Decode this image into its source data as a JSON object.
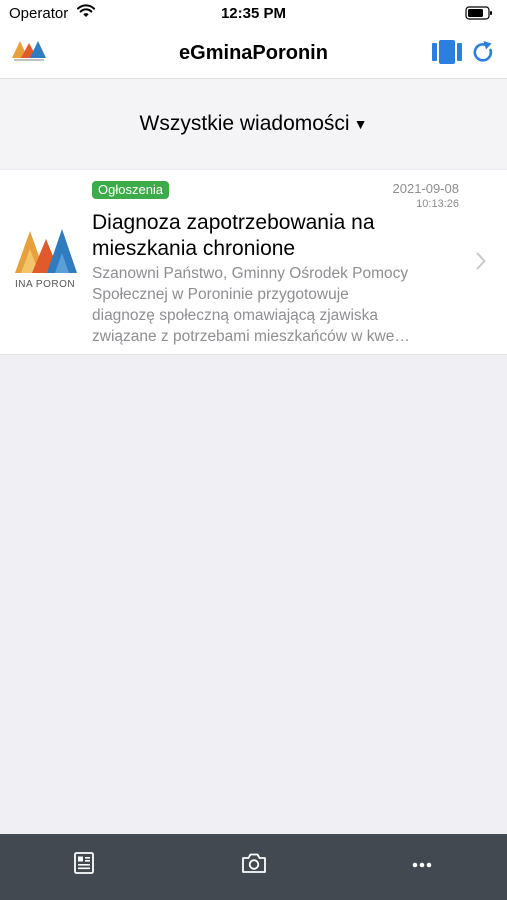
{
  "status_bar": {
    "carrier": "Operator",
    "time": "12:35 PM"
  },
  "nav": {
    "title": "eGminaPoronin",
    "accent_color": "#2a7fe0"
  },
  "filter": {
    "label": "Wszystkie wiadomości",
    "caret": "▼"
  },
  "messages": [
    {
      "category": "Ogłoszenia",
      "category_color": "#3dab4a",
      "date": "2021-09-08",
      "time": "10:13:26",
      "title": "Diagnoza zapotrzebowania na mieszkania chronione",
      "excerpt_lines": [
        "Szanowni Państwo, Gminny Ośrodek Pomocy",
        "Społecznej w Poroninie przygotowuje",
        "diagnozę społeczną omawiającą zjawiska",
        "związane z potrzebami mieszkańców w kwe…"
      ],
      "thumb_text": "INA PORON"
    }
  ],
  "tab_bar": {
    "background": "#424950",
    "tabs": [
      "document-icon",
      "camera-icon",
      "more-icon"
    ]
  }
}
